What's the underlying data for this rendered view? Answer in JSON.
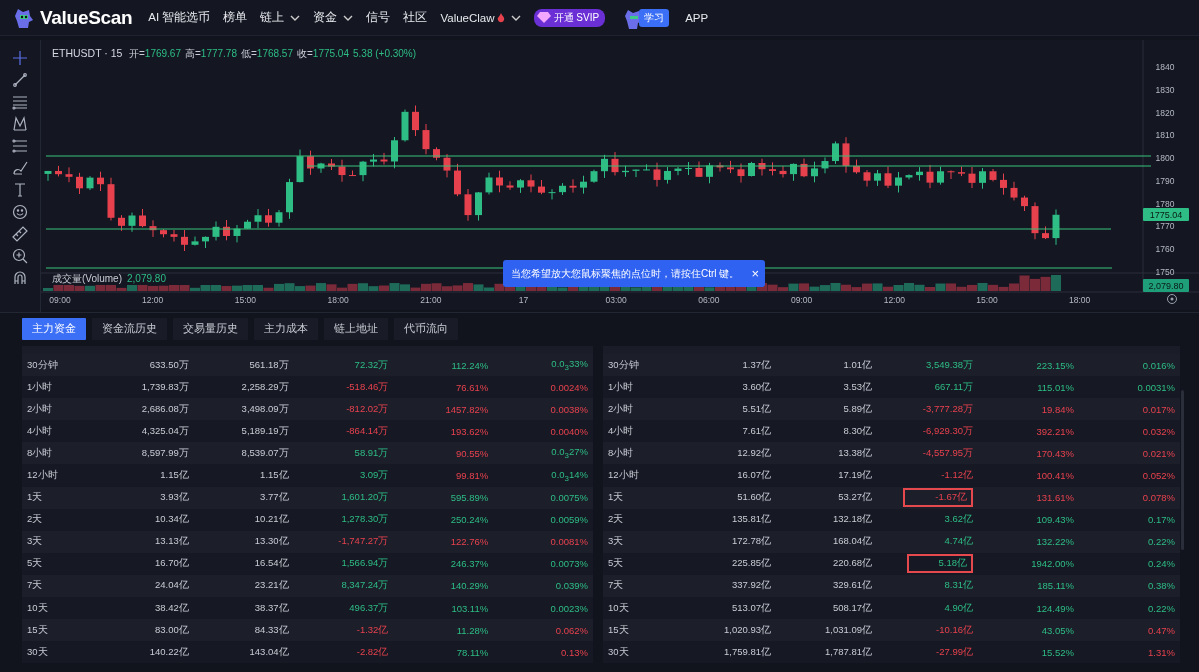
{
  "header": {
    "brand": "ValueScan",
    "nav": [
      {
        "label": "AI 智能选币",
        "dropdown": false,
        "hot": false
      },
      {
        "label": "榜单",
        "dropdown": false,
        "hot": false
      },
      {
        "label": "链上",
        "dropdown": true,
        "hot": false
      },
      {
        "label": "资金",
        "dropdown": true,
        "hot": false
      },
      {
        "label": "信号",
        "dropdown": false,
        "hot": false
      },
      {
        "label": "社区",
        "dropdown": false,
        "hot": false
      },
      {
        "label": "ValueClaw",
        "dropdown": true,
        "hot": true
      }
    ],
    "svip": "开通 SVIP",
    "learn": "学习",
    "app": "APP"
  },
  "chart": {
    "symbol": "ETHUSDT · 15",
    "ohlc": [
      {
        "label": "开=",
        "value": "1769.67"
      },
      {
        "label": "高=",
        "value": "1777.78"
      },
      {
        "label": "低=",
        "value": "1768.57"
      },
      {
        "label": "收=",
        "value": "1775.04"
      }
    ],
    "change": "5.38 (+0.30%)",
    "volume_label": "成交量(Volume)",
    "volume_value": "2,079.80",
    "yticks": [
      "1840",
      "1830",
      "1820",
      "1810",
      "1800",
      "1790",
      "1780",
      "1770",
      "1760",
      "1750"
    ],
    "last_price": "1775.04",
    "volume_tag": "2,079.80",
    "xticks": [
      "09:00",
      "12:00",
      "15:00",
      "18:00",
      "21:00",
      "17",
      "03:00",
      "06:00",
      "09:00",
      "12:00",
      "15:00",
      "18:00"
    ],
    "toast": {
      "text": "当您希望放大您鼠标聚焦的点位时，请按住Ctrl 键。",
      "close": "×"
    }
  },
  "tabs": [
    {
      "label": "主力资金",
      "selected": true
    },
    {
      "label": "资金流历史",
      "selected": false
    },
    {
      "label": "交易量历史",
      "selected": false
    },
    {
      "label": "主力成本",
      "selected": false
    },
    {
      "label": "链上地址",
      "selected": false
    },
    {
      "label": "代币流向",
      "selected": false
    }
  ],
  "tables": [
    {
      "rows": [
        {
          "cells": [
            "30分钟",
            "633.50万",
            "561.18万"
          ],
          "signed": [
            {
              "text": "72.32万",
              "up": true
            },
            {
              "text": "112.24%",
              "up": true
            },
            {
              "text": "0.0$_{3}$33%",
              "up": true
            }
          ]
        },
        {
          "cells": [
            "1小时",
            "1,739.83万",
            "2,258.29万"
          ],
          "signed": [
            {
              "text": "-518.46万",
              "up": false
            },
            {
              "text": "76.61%",
              "up": false
            },
            {
              "text": "0.0024%",
              "up": false
            }
          ]
        },
        {
          "cells": [
            "2小时",
            "2,686.08万",
            "3,498.09万"
          ],
          "signed": [
            {
              "text": "-812.02万",
              "up": false
            },
            {
              "text": "1457.82%",
              "up": false
            },
            {
              "text": "0.0038%",
              "up": false
            }
          ]
        },
        {
          "cells": [
            "4小时",
            "4,325.04万",
            "5,189.19万"
          ],
          "signed": [
            {
              "text": "-864.14万",
              "up": false
            },
            {
              "text": "193.62%",
              "up": false
            },
            {
              "text": "0.0040%",
              "up": false
            }
          ]
        },
        {
          "cells": [
            "8小时",
            "8,597.99万",
            "8,539.07万"
          ],
          "signed": [
            {
              "text": "58.91万",
              "up": true
            },
            {
              "text": "90.55%",
              "up": false
            },
            {
              "text": "0.0$_{3}$27%",
              "up": true
            }
          ]
        },
        {
          "cells": [
            "12小时",
            "1.15亿",
            "1.15亿"
          ],
          "signed": [
            {
              "text": "3.09万",
              "up": true
            },
            {
              "text": "99.81%",
              "up": false
            },
            {
              "text": "0.0$_{3}$14%",
              "up": true
            }
          ]
        },
        {
          "cells": [
            "1天",
            "3.93亿",
            "3.77亿"
          ],
          "signed": [
            {
              "text": "1,601.20万",
              "up": true
            },
            {
              "text": "595.89%",
              "up": true
            },
            {
              "text": "0.0075%",
              "up": true
            }
          ]
        },
        {
          "cells": [
            "2天",
            "10.34亿",
            "10.21亿"
          ],
          "signed": [
            {
              "text": "1,278.30万",
              "up": true
            },
            {
              "text": "250.24%",
              "up": true
            },
            {
              "text": "0.0059%",
              "up": true
            }
          ]
        },
        {
          "cells": [
            "3天",
            "13.13亿",
            "13.30亿"
          ],
          "signed": [
            {
              "text": "-1,747.27万",
              "up": false
            },
            {
              "text": "122.76%",
              "up": false
            },
            {
              "text": "0.0081%",
              "up": false
            }
          ]
        },
        {
          "cells": [
            "5天",
            "16.70亿",
            "16.54亿"
          ],
          "signed": [
            {
              "text": "1,566.94万",
              "up": true
            },
            {
              "text": "246.37%",
              "up": true
            },
            {
              "text": "0.0073%",
              "up": true
            }
          ]
        },
        {
          "cells": [
            "7天",
            "24.04亿",
            "23.21亿"
          ],
          "signed": [
            {
              "text": "8,347.24万",
              "up": true
            },
            {
              "text": "140.29%",
              "up": true
            },
            {
              "text": "0.039%",
              "up": true
            }
          ]
        },
        {
          "cells": [
            "10天",
            "38.42亿",
            "38.37亿"
          ],
          "signed": [
            {
              "text": "496.37万",
              "up": true
            },
            {
              "text": "103.11%",
              "up": true
            },
            {
              "text": "0.0023%",
              "up": true
            }
          ]
        },
        {
          "cells": [
            "15天",
            "83.00亿",
            "84.33亿"
          ],
          "signed": [
            {
              "text": "-1.32亿",
              "up": false
            },
            {
              "text": "11.28%",
              "up": true
            },
            {
              "text": "0.062%",
              "up": false
            }
          ]
        },
        {
          "cells": [
            "30天",
            "140.22亿",
            "143.04亿"
          ],
          "signed": [
            {
              "text": "-2.82亿",
              "up": false
            },
            {
              "text": "78.11%",
              "up": true
            },
            {
              "text": "0.13%",
              "up": false
            }
          ]
        }
      ]
    },
    {
      "rows": [
        {
          "cells": [
            "30分钟",
            "1.37亿",
            "1.01亿"
          ],
          "signed": [
            {
              "text": "3,549.38万",
              "up": true
            },
            {
              "text": "223.15%",
              "up": true
            },
            {
              "text": "0.016%",
              "up": true
            }
          ]
        },
        {
          "cells": [
            "1小时",
            "3.60亿",
            "3.53亿"
          ],
          "signed": [
            {
              "text": "667.11万",
              "up": true
            },
            {
              "text": "115.01%",
              "up": true
            },
            {
              "text": "0.0031%",
              "up": true
            }
          ]
        },
        {
          "cells": [
            "2小时",
            "5.51亿",
            "5.89亿"
          ],
          "signed": [
            {
              "text": "-3,777.28万",
              "up": false
            },
            {
              "text": "19.84%",
              "up": false
            },
            {
              "text": "0.017%",
              "up": false
            }
          ]
        },
        {
          "cells": [
            "4小时",
            "7.61亿",
            "8.30亿"
          ],
          "signed": [
            {
              "text": "-6,929.30万",
              "up": false
            },
            {
              "text": "392.21%",
              "up": false
            },
            {
              "text": "0.032%",
              "up": false
            }
          ]
        },
        {
          "cells": [
            "8小时",
            "12.92亿",
            "13.38亿"
          ],
          "signed": [
            {
              "text": "-4,557.95万",
              "up": false
            },
            {
              "text": "170.43%",
              "up": false
            },
            {
              "text": "0.021%",
              "up": false
            }
          ]
        },
        {
          "cells": [
            "12小时",
            "16.07亿",
            "17.19亿"
          ],
          "signed": [
            {
              "text": "-1.12亿",
              "up": false
            },
            {
              "text": "100.41%",
              "up": false
            },
            {
              "text": "0.052%",
              "up": false
            }
          ]
        },
        {
          "cells": [
            "1天",
            "51.60亿",
            "53.27亿"
          ],
          "signed": [
            {
              "text": "-1.67亿",
              "up": false,
              "boxed": true
            },
            {
              "text": "131.61%",
              "up": false
            },
            {
              "text": "0.078%",
              "up": false
            }
          ]
        },
        {
          "cells": [
            "2天",
            "135.81亿",
            "132.18亿"
          ],
          "signed": [
            {
              "text": "3.62亿",
              "up": true
            },
            {
              "text": "109.43%",
              "up": true
            },
            {
              "text": "0.17%",
              "up": true
            }
          ]
        },
        {
          "cells": [
            "3天",
            "172.78亿",
            "168.04亿"
          ],
          "signed": [
            {
              "text": "4.74亿",
              "up": true
            },
            {
              "text": "132.22%",
              "up": true
            },
            {
              "text": "0.22%",
              "up": true
            }
          ]
        },
        {
          "cells": [
            "5天",
            "225.85亿",
            "220.68亿"
          ],
          "signed": [
            {
              "text": "5.18亿",
              "up": true,
              "boxed": true
            },
            {
              "text": "1942.00%",
              "up": true
            },
            {
              "text": "0.24%",
              "up": true
            }
          ]
        },
        {
          "cells": [
            "7天",
            "337.92亿",
            "329.61亿"
          ],
          "signed": [
            {
              "text": "8.31亿",
              "up": true
            },
            {
              "text": "185.11%",
              "up": true
            },
            {
              "text": "0.38%",
              "up": true
            }
          ]
        },
        {
          "cells": [
            "10天",
            "513.07亿",
            "508.17亿"
          ],
          "signed": [
            {
              "text": "4.90亿",
              "up": true
            },
            {
              "text": "124.49%",
              "up": true
            },
            {
              "text": "0.22%",
              "up": true
            }
          ]
        },
        {
          "cells": [
            "15天",
            "1,020.93亿",
            "1,031.09亿"
          ],
          "signed": [
            {
              "text": "-10.16亿",
              "up": false
            },
            {
              "text": "43.05%",
              "up": true
            },
            {
              "text": "0.47%",
              "up": false
            }
          ]
        },
        {
          "cells": [
            "30天",
            "1,759.81亿",
            "1,787.81亿"
          ],
          "signed": [
            {
              "text": "-27.99亿",
              "up": false
            },
            {
              "text": "15.52%",
              "up": true
            },
            {
              "text": "1.31%",
              "up": false
            }
          ]
        }
      ]
    }
  ]
}
